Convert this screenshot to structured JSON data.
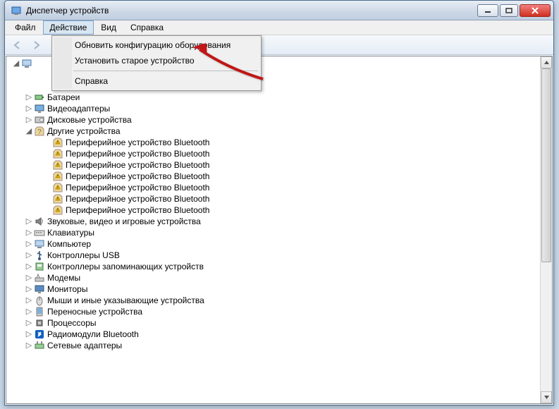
{
  "window": {
    "title": "Диспетчер устройств"
  },
  "menubar": {
    "file": "Файл",
    "action": "Действие",
    "view": "Вид",
    "help": "Справка"
  },
  "dropdown": {
    "scan": "Обновить конфигурацию оборудования",
    "legacy": "Установить старое устройство",
    "help": "Справка"
  },
  "tree": {
    "root": "",
    "items": [
      {
        "label": "Батареи",
        "icon": "battery",
        "expanded": false
      },
      {
        "label": "Видеоадаптеры",
        "icon": "display",
        "expanded": false
      },
      {
        "label": "Дисковые устройства",
        "icon": "disk",
        "expanded": false
      },
      {
        "label": "Другие устройства",
        "icon": "other",
        "expanded": true,
        "children": [
          {
            "label": "Периферийное устройство Bluetooth",
            "icon": "warn"
          },
          {
            "label": "Периферийное устройство Bluetooth",
            "icon": "warn"
          },
          {
            "label": "Периферийное устройство Bluetooth",
            "icon": "warn"
          },
          {
            "label": "Периферийное устройство Bluetooth",
            "icon": "warn"
          },
          {
            "label": "Периферийное устройство Bluetooth",
            "icon": "warn"
          },
          {
            "label": "Периферийное устройство Bluetooth",
            "icon": "warn"
          },
          {
            "label": "Периферийное устройство Bluetooth",
            "icon": "warn"
          }
        ]
      },
      {
        "label": "Звуковые, видео и игровые устройства",
        "icon": "sound",
        "expanded": false
      },
      {
        "label": "Клавиатуры",
        "icon": "keyboard",
        "expanded": false
      },
      {
        "label": "Компьютер",
        "icon": "computer",
        "expanded": false
      },
      {
        "label": "Контроллеры USB",
        "icon": "usb",
        "expanded": false
      },
      {
        "label": "Контроллеры запоминающих устройств",
        "icon": "storage",
        "expanded": false
      },
      {
        "label": "Модемы",
        "icon": "modem",
        "expanded": false
      },
      {
        "label": "Мониторы",
        "icon": "monitor",
        "expanded": false
      },
      {
        "label": "Мыши и иные указывающие устройства",
        "icon": "mouse",
        "expanded": false
      },
      {
        "label": "Переносные устройства",
        "icon": "portable",
        "expanded": false
      },
      {
        "label": "Процессоры",
        "icon": "cpu",
        "expanded": false
      },
      {
        "label": "Радиомодули Bluetooth",
        "icon": "bluetooth",
        "expanded": false
      },
      {
        "label": "Сетевые адаптеры",
        "icon": "network",
        "expanded": false
      }
    ],
    "hidden_top": ""
  }
}
